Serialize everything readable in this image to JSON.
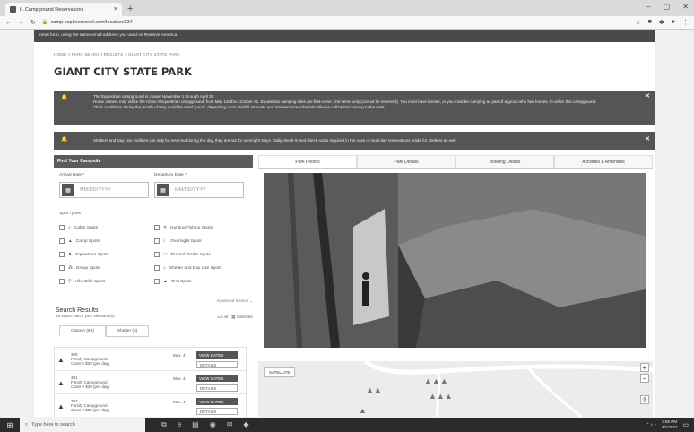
{
  "browser": {
    "tab_title": "IL Campground Reservations",
    "url": "camp.exploremoreil.com/location/234"
  },
  "top_banner": "reset form, using the same email address you used on Reserve America.",
  "breadcrumb": "HOME > PARK SEARCH RESULTS > GIANT CITY STATE PARK",
  "park_title": "GIANT CITY STATE PARK",
  "alerts": [
    {
      "line1": "The Equestrian campground is closed November 1 through April 30.",
      "line2": "Horse owners may utilize the Class A Equestrian campground, from May 1st thru October 31. Equestrian camping sites are first-come, first serve only (cannot be reserved). You must have horses, or you must be camping as part of a group who has horses, to utilize this campground.",
      "line3": "*Trail conditions during the month of May could be rated \"poor\", depending upon rainfall amounts and maintenance schedule. Please call before coming to the Park."
    },
    {
      "line1": "Shelters and Day Use facilities can only be reserved during the day, they are not for overnight stays. Daily check-in and check-out is required in the case of multi-day reservations made for shelters as well."
    }
  ],
  "finder": {
    "header": "Find Your Campsite",
    "arrival_label": "Arrival Date *",
    "departure_label": "Departure Date *",
    "date_placeholder": "MM/DD/YYYY",
    "spot_types_label": "Spot Types",
    "spots_left": [
      "Cabin Spots",
      "Camp Spots",
      "Equestrian Spots",
      "Group Spots",
      "Hike/Bike Spots"
    ],
    "spots_right": [
      "Hunting/Fishing Spots",
      "Overnight Spots",
      "RV and Trailer Spots",
      "Shelter and Day Use Spots",
      "Tent Spots"
    ],
    "advanced_search": "Advanced Search"
  },
  "results": {
    "title": "Search Results",
    "subtitle": "69 Spots match your selection(s)",
    "view_list": "List",
    "view_calendar": "Calendar",
    "tabs": [
      "Class A (69)",
      "Shelter (0)"
    ],
    "rows": [
      {
        "id": "300",
        "type": "Family Campground",
        "price": "Class A $20 (per day)",
        "max": "Max. 4"
      },
      {
        "id": "301",
        "type": "Family Campground",
        "price": "Class A $20 (per day)",
        "max": "Max. 4"
      },
      {
        "id": "302",
        "type": "Family Campground",
        "price": "Class A $20 (per day)",
        "max": "Max. 4"
      }
    ],
    "view_dates": "VIEW DATES",
    "details": "DETAILS"
  },
  "right_tabs": [
    "Park Photos",
    "Park Details",
    "Booking Details",
    "Activities & Amenities"
  ],
  "map": {
    "satellite": "SATELLITE"
  },
  "taskbar": {
    "search": "Type here to search",
    "time": "3:55 PM",
    "date": "3/1/2021"
  },
  "colors": {
    "dark_bar": "#555555",
    "taskbar": "#2b2b2b"
  }
}
